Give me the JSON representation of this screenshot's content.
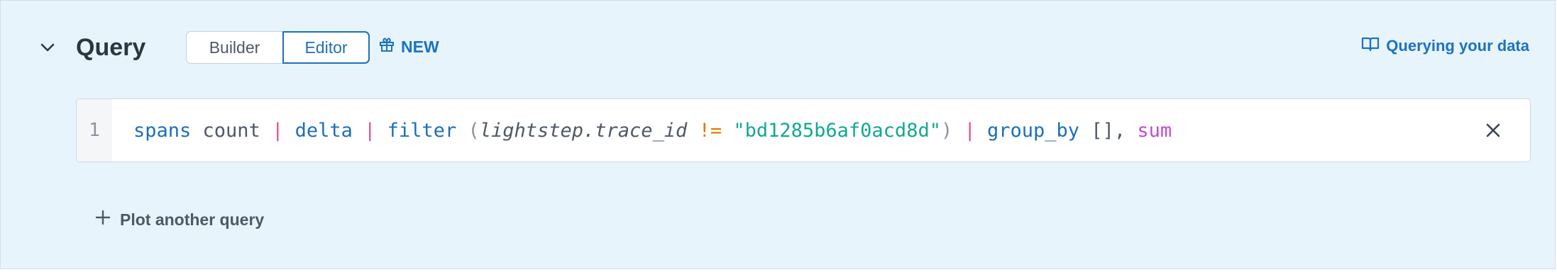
{
  "query": {
    "title": "Query",
    "toggle": {
      "builder_label": "Builder",
      "editor_label": "Editor",
      "selected": "Editor"
    },
    "new_badge": "NEW",
    "docs_link": "Querying your data",
    "editor": {
      "line_number": "1",
      "tokens": [
        {
          "text": "spans",
          "kind": "kw"
        },
        {
          "text": " count ",
          "kind": "plain"
        },
        {
          "text": "|",
          "kind": "pipe"
        },
        {
          "text": " delta ",
          "kind": "kw"
        },
        {
          "text": "|",
          "kind": "pipe"
        },
        {
          "text": " filter ",
          "kind": "kw"
        },
        {
          "text": "(",
          "kind": "paren"
        },
        {
          "text": "lightstep.trace_id",
          "kind": "ident"
        },
        {
          "text": " != ",
          "kind": "op"
        },
        {
          "text": "\"bd1285b6af0acd8d\"",
          "kind": "str"
        },
        {
          "text": ")",
          "kind": "paren"
        },
        {
          "text": " | ",
          "kind": "pipe"
        },
        {
          "text": "group_by",
          "kind": "kw"
        },
        {
          "text": " [], ",
          "kind": "plain"
        },
        {
          "text": "sum",
          "kind": "agg"
        }
      ]
    },
    "plot_another_label": "Plot another query"
  },
  "icons": {
    "collapse": "chevron-down-icon",
    "new": "gift-icon",
    "docs": "book-open-icon",
    "clear": "close-icon",
    "add": "plus-icon"
  },
  "colors": {
    "panel_bg": "#e8f4fb",
    "accent": "#1b73c0",
    "pipe": "#e0528f",
    "operator": "#e07b00",
    "string": "#12a890",
    "aggregate": "#c04ad6"
  }
}
